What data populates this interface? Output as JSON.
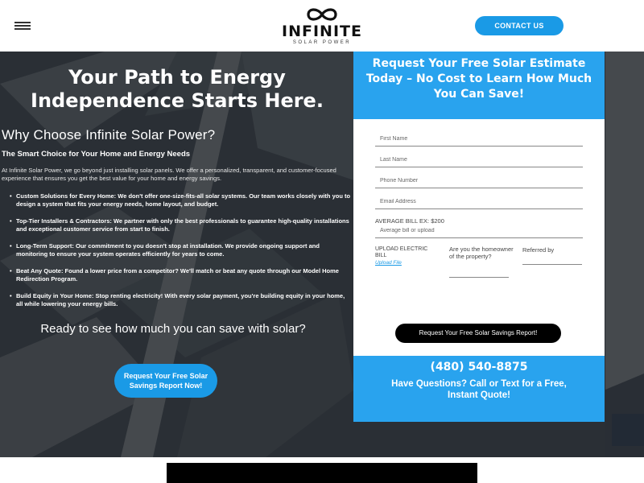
{
  "header": {
    "logo_name": "INFINITE",
    "logo_sub": "SOLAR POWER",
    "contact_label": "CONTACT US"
  },
  "hero": {
    "title": "Your Path to Energy Independence Starts Here.",
    "why_title": "Why Choose Infinite Solar Power?",
    "why_subtitle": "The Smart Choice for Your Home and Energy Needs",
    "intro": "At Infinite Solar Power, we go beyond just installing solar panels. We offer a personalized, transparent, and customer-focused experience that ensures you get the best value for your home and energy savings.",
    "features": [
      "Custom Solutions for Every Home: We don't offer one-size-fits-all solar systems. Our team works closely with you to design a system that fits your energy needs, home layout, and budget.",
      "Top-Tier Installers & Contractors: We partner with only the best professionals to guarantee high-quality installations and exceptional customer service from start to finish.",
      "Long-Term Support: Our commitment to you doesn't stop at installation. We provide ongoing support and monitoring to ensure your system operates efficiently for years to come.",
      "Beat Any Quote: Found a lower price from a competitor? We'll match or beat any quote through our Model Home Redirection Program.",
      "Build Equity in Your Home: Stop renting electricity! With every solar payment, you're building equity in your home, all while lowering your energy bills."
    ],
    "ready_text": "Ready to see how much you can save with solar?",
    "cta_label": "Request Your Free Solar Savings Report Now!"
  },
  "form": {
    "heading": "Request Your Free Solar Estimate Today – No Cost to Learn How Much You Can Save!",
    "first_name_placeholder": "First Name",
    "last_name_placeholder": "Last Name",
    "phone_placeholder": "Phone Number",
    "email_placeholder": "Email Address",
    "bill_label": "AVERAGE BILL EX: $200",
    "bill_placeholder": "Average bill or upload",
    "upload_label": "UPLOAD ELECTRIC BILL",
    "upload_link": "Upload File",
    "homeowner_label": "Are you the homeowner of the property?",
    "referred_label": "Referred by",
    "submit_label": "Request Your Free Solar Savings Report!",
    "phone_number": "(480) 540-8875",
    "questions_text": "Have Questions? Call or Text for a Free, Instant Quote!"
  },
  "colors": {
    "accent": "#1a9ae6",
    "panel_blue": "#29a3ee",
    "button_dark": "#000000"
  }
}
